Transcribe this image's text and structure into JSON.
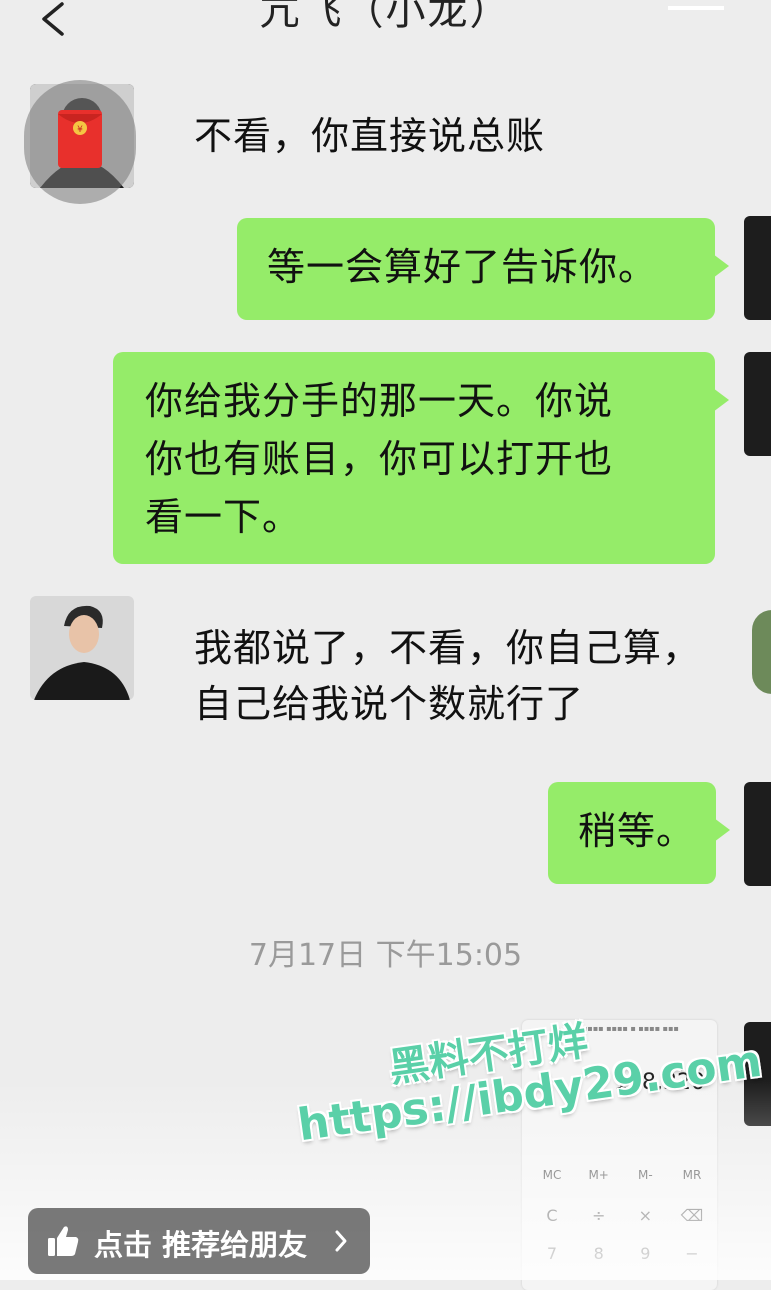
{
  "header": {
    "title": "亢飞（小龙）"
  },
  "messages": [
    {
      "side": "left",
      "text": "不看，你直接说总账"
    },
    {
      "side": "right",
      "text": "等一会算好了告诉你。"
    },
    {
      "side": "right",
      "lines": [
        "你给我分手的那一天。你说",
        "你也有账目，你可以打开也",
        "看一下。"
      ]
    },
    {
      "side": "left",
      "lines": [
        "我都说了，不看，你自己算，",
        "自己给我说个数就行了"
      ]
    },
    {
      "side": "right",
      "text": "稍等。"
    }
  ],
  "timestamp": "7月17日 下午15:05",
  "calculator": {
    "display": "128,320",
    "keys_row1": [
      "MC",
      "M+",
      "M-",
      "MR"
    ],
    "keys_row2": [
      "C",
      "÷",
      "×",
      "⌫"
    ],
    "keys_row3": [
      "7",
      "8",
      "9",
      "−"
    ]
  },
  "watermark": {
    "line1": "黑料不打烊",
    "line2": "https://ibdy29.com"
  },
  "recommend": {
    "label": "点击 推荐给朋友",
    "icon": "thumbs-up-icon"
  },
  "colors": {
    "background": "#ededed",
    "bubble_green": "#95ec69",
    "watermark": "#5ad0a8"
  }
}
